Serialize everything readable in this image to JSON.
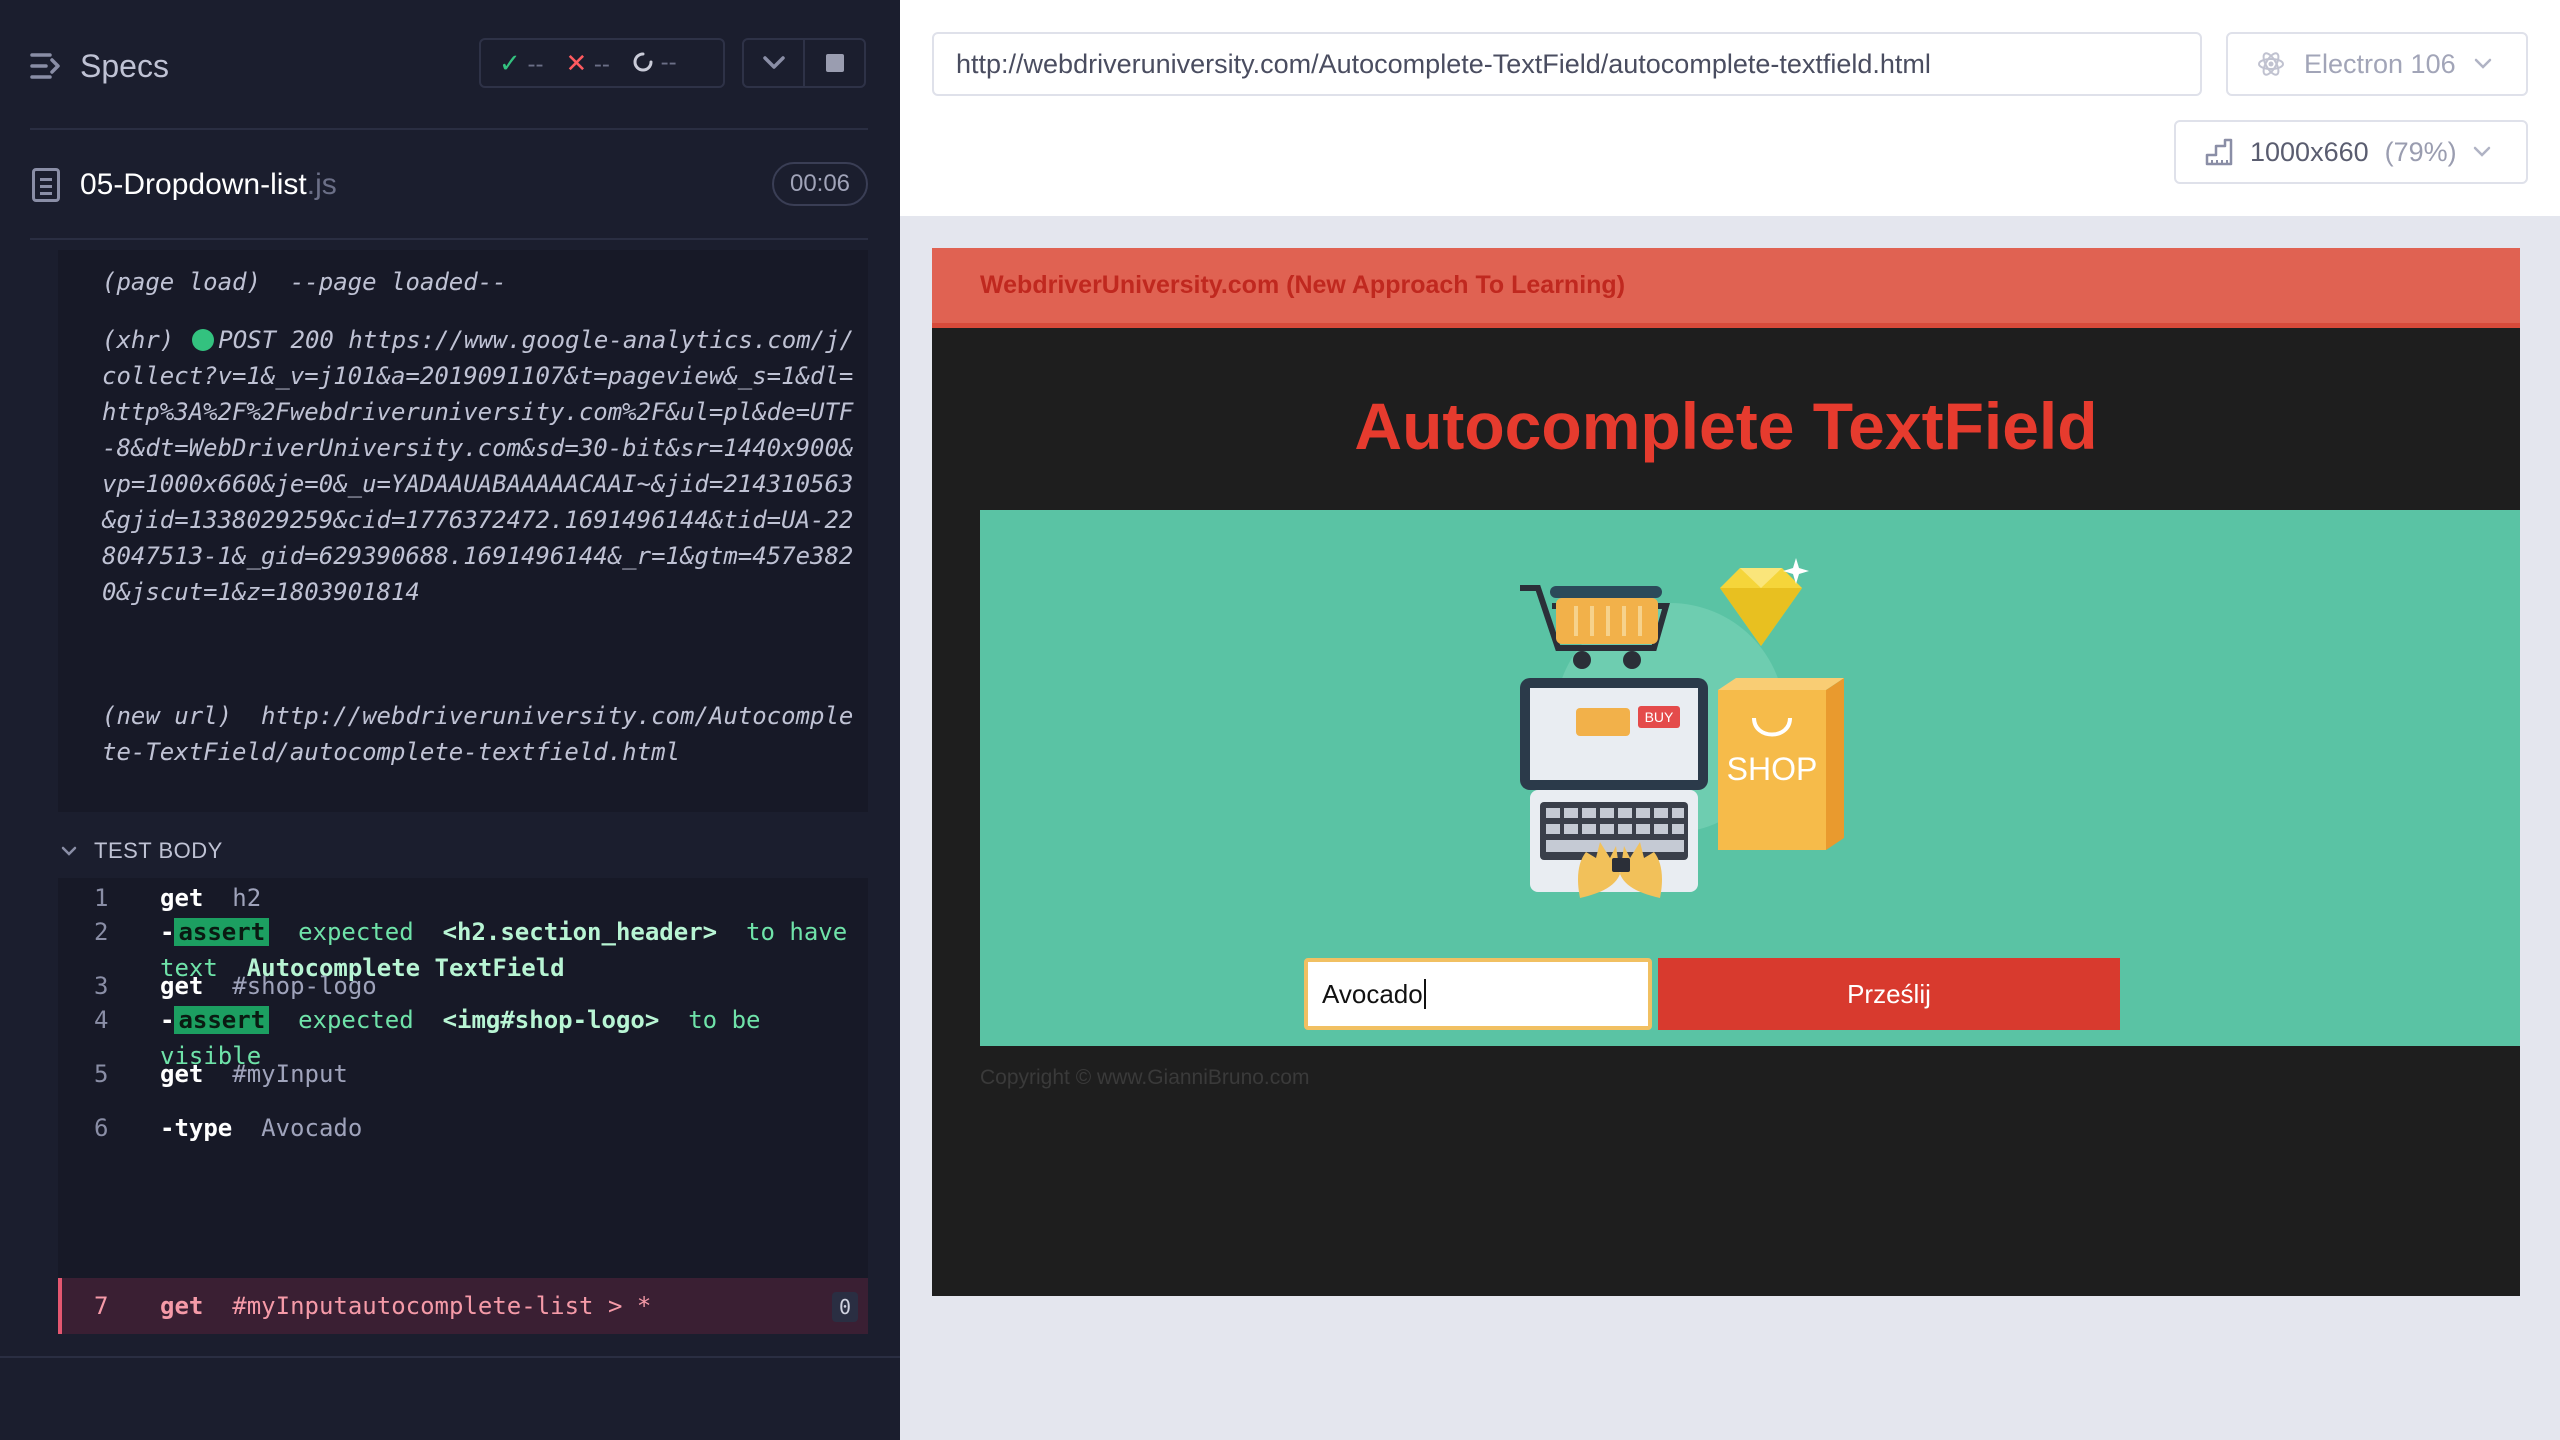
{
  "reporter": {
    "specs_label": "Specs",
    "stats": {
      "passed": "--",
      "failed": "--",
      "pending": "--"
    },
    "spec": {
      "name": "05-Dropdown-list",
      "ext": ".js",
      "time": "00:06"
    },
    "log": [
      {
        "type": "(page load)",
        "text": "--page loaded--"
      },
      {
        "type": "(xhr)",
        "text": "POST 200 https://www.google-analytics.com/j/collect?v=1&_v=j101&a=2019091107&t=pageview&_s=1&dl=http%3A%2F%2Fwebdriveruniversity.com%2F&ul=pl&de=UTF-8&dt=WebDriverUniversity.com&sd=30-bit&sr=1440x900&vp=1000x660&je=0&_u=YADAAUABAAAAACAAI~&jid=214310563&gjid=1338029259&cid=1776372472.1691496144&tid=UA-228047513-1&_gid=629390688.1691496144&_r=1&gtm=457e3820&jscut=1&z=1803901814"
      },
      {
        "type": "(new url)",
        "text": "http://webdriveruniversity.com/Autocomplete-TextField/autocomplete-textfield.html"
      }
    ],
    "test_body_label": "TEST BODY",
    "commands": [
      {
        "num": "1",
        "name": "get",
        "arg": "h2"
      },
      {
        "num": "2",
        "prefix": "-",
        "tag": "assert",
        "expected": "expected",
        "subject": "<h2.section_header>",
        "verb": "to have text",
        "value": "Autocomplete TextField"
      },
      {
        "num": "3",
        "name": "get",
        "arg": "#shop-logo"
      },
      {
        "num": "4",
        "prefix": "-",
        "tag": "assert",
        "expected": "expected",
        "subject": "<img#shop-logo>",
        "verb": "to be visible"
      },
      {
        "num": "5",
        "name": "get",
        "arg": "#myInput"
      },
      {
        "num": "6",
        "name": "-type",
        "arg": "Avocado"
      },
      {
        "num": "7",
        "name": "get",
        "arg": "#myInputautocomplete-list > *",
        "badge": "0"
      }
    ]
  },
  "browser": {
    "url": "http://webdriveruniversity.com/Autocomplete-TextField/autocomplete-textfield.html",
    "browser_name": "Electron 106",
    "viewport": "1000x660",
    "scale": "(79%)"
  },
  "site": {
    "banner": "WebdriverUniversity.com (New Approach To Learning)",
    "title": "Autocomplete TextField",
    "input_value": "Avocado",
    "submit_label": "Prześlij",
    "copyright": "Copyright © www.GianniBruno.com",
    "logo_text": {
      "buy": "BUY",
      "shop": "SHOP"
    }
  },
  "colors": {
    "reporter_bg": "#1b1e2e",
    "banner": "#e06252",
    "title": "#e63b2e",
    "teal": "#5ac3a4",
    "submit": "#d83a2e",
    "pass": "#33c27f",
    "fail": "#ff5a5f"
  }
}
